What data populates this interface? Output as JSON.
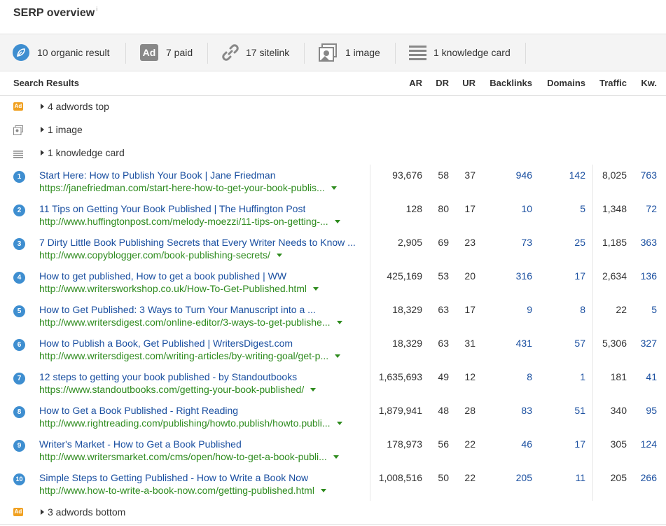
{
  "header": {
    "title": "SERP overview",
    "info_mark": "i"
  },
  "summary": [
    {
      "icon": "compass-icon",
      "label": "10 organic result"
    },
    {
      "icon": "ad-icon",
      "icon_text": "Ad",
      "label": "7 paid"
    },
    {
      "icon": "link-icon",
      "label": "17 sitelink"
    },
    {
      "icon": "image-icon",
      "label": "1 image"
    },
    {
      "icon": "knowledge-card-icon",
      "label": "1 knowledge card"
    }
  ],
  "columns": {
    "results": "Search Results",
    "ar": "AR",
    "dr": "DR",
    "ur": "UR",
    "backlinks": "Backlinks",
    "domains": "Domains",
    "traffic": "Traffic",
    "kw": "Kw."
  },
  "features": {
    "adwords_top": {
      "label": "4 adwords top",
      "icon_text": "Ad"
    },
    "image": {
      "label": "1 image"
    },
    "knowledge": {
      "label": "1 knowledge card"
    },
    "adwords_bottom": {
      "label": "3 adwords bottom",
      "icon_text": "Ad"
    }
  },
  "results": [
    {
      "rank": "1",
      "title": "Start Here: How to Publish Your Book | Jane Friedman",
      "url": "https://janefriedman.com/start-here-how-to-get-your-book-publis...",
      "ar": "93,676",
      "dr": "58",
      "ur": "37",
      "backlinks": "946",
      "domains": "142",
      "traffic": "8,025",
      "kw": "763"
    },
    {
      "rank": "2",
      "title": "11 Tips on Getting Your Book Published | The Huffington Post",
      "url": "http://www.huffingtonpost.com/melody-moezzi/11-tips-on-getting-...",
      "ar": "128",
      "dr": "80",
      "ur": "17",
      "backlinks": "10",
      "domains": "5",
      "traffic": "1,348",
      "kw": "72"
    },
    {
      "rank": "3",
      "title": "7 Dirty Little Book Publishing Secrets that Every Writer Needs to Know ...",
      "url": "http://www.copyblogger.com/book-publishing-secrets/",
      "ar": "2,905",
      "dr": "69",
      "ur": "23",
      "backlinks": "73",
      "domains": "25",
      "traffic": "1,185",
      "kw": "363"
    },
    {
      "rank": "4",
      "title": "How to get published, How to get a book published | WW",
      "url": "http://www.writersworkshop.co.uk/How-To-Get-Published.html",
      "ar": "425,169",
      "dr": "53",
      "ur": "20",
      "backlinks": "316",
      "domains": "17",
      "traffic": "2,634",
      "kw": "136"
    },
    {
      "rank": "5",
      "title": "How to Get Published: 3 Ways to Turn Your Manuscript into a ...",
      "url": "http://www.writersdigest.com/online-editor/3-ways-to-get-publishe...",
      "ar": "18,329",
      "dr": "63",
      "ur": "17",
      "backlinks": "9",
      "domains": "8",
      "traffic": "22",
      "kw": "5"
    },
    {
      "rank": "6",
      "title": "How to Publish a Book, Get Published | WritersDigest.com",
      "url": "http://www.writersdigest.com/writing-articles/by-writing-goal/get-p...",
      "ar": "18,329",
      "dr": "63",
      "ur": "31",
      "backlinks": "431",
      "domains": "57",
      "traffic": "5,306",
      "kw": "327"
    },
    {
      "rank": "7",
      "title": "12 steps to getting your book published - by Standoutbooks",
      "url": "https://www.standoutbooks.com/getting-your-book-published/",
      "ar": "1,635,693",
      "dr": "49",
      "ur": "12",
      "backlinks": "8",
      "domains": "1",
      "traffic": "181",
      "kw": "41"
    },
    {
      "rank": "8",
      "title": "How to Get a Book Published - Right Reading",
      "url": "http://www.rightreading.com/publishing/howto.publish/howto.publi...",
      "ar": "1,879,941",
      "dr": "48",
      "ur": "28",
      "backlinks": "83",
      "domains": "51",
      "traffic": "340",
      "kw": "95"
    },
    {
      "rank": "9",
      "title": "Writer's Market - How to Get a Book Published",
      "url": "http://www.writersmarket.com/cms/open/how-to-get-a-book-publi...",
      "ar": "178,973",
      "dr": "56",
      "ur": "22",
      "backlinks": "46",
      "domains": "17",
      "traffic": "305",
      "kw": "124"
    },
    {
      "rank": "10",
      "title": "Simple Steps to Getting Published - How to Write a Book Now",
      "url": "http://www.how-to-write-a-book-now.com/getting-published.html",
      "ar": "1,008,516",
      "dr": "50",
      "ur": "22",
      "backlinks": "205",
      "domains": "11",
      "traffic": "205",
      "kw": "266"
    }
  ],
  "colors": {
    "link": "#1a4fa0",
    "url": "#2e8b1e",
    "badge": "#3e8ed0",
    "ad_orange": "#f0a020"
  }
}
